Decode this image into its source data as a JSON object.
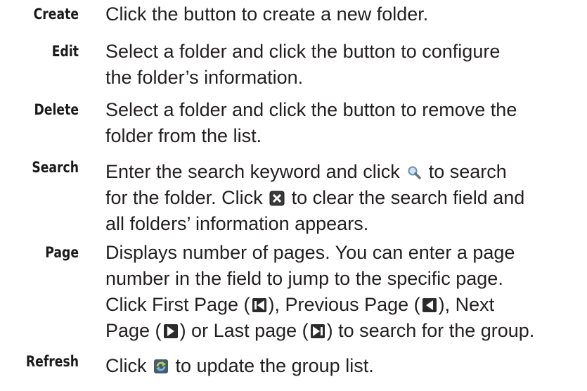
{
  "rows": [
    {
      "term": "Create",
      "lines": [
        "Click the button to create a new folder."
      ]
    },
    {
      "term": "Edit",
      "lines": [
        "Select a folder and click the button to configure",
        "the folder’s information."
      ]
    },
    {
      "term": "Delete",
      "lines": [
        "Select a folder and click the button to remove the",
        "folder from the list."
      ]
    },
    {
      "term": "Search",
      "line1_a": "Enter the search keyword and click ",
      "line1_b": " to search",
      "line2_a": "for the folder. Click ",
      "line2_b": " to clear the search field and",
      "line3": "all folders’ information appears."
    },
    {
      "term": "Page",
      "line1": "Displays number of pages. You can enter a page",
      "line2": "number in the field to jump to the specific page.",
      "line3_a": "Click First Page (",
      "line3_b": "), Previous Page (",
      "line3_c": "), Next",
      "line4_a": "Page (",
      "line4_b": ") or Last page (",
      "line4_c": ") to search for the group."
    },
    {
      "term": "Refresh",
      "line1_a": "Click ",
      "line1_b": " to update the group list."
    }
  ],
  "icons": {
    "search": "magnifier-icon",
    "clear": "close-x-icon",
    "first": "first-page-icon",
    "prev": "previous-page-icon",
    "next": "next-page-icon",
    "last": "last-page-icon",
    "refresh": "refresh-icon"
  }
}
